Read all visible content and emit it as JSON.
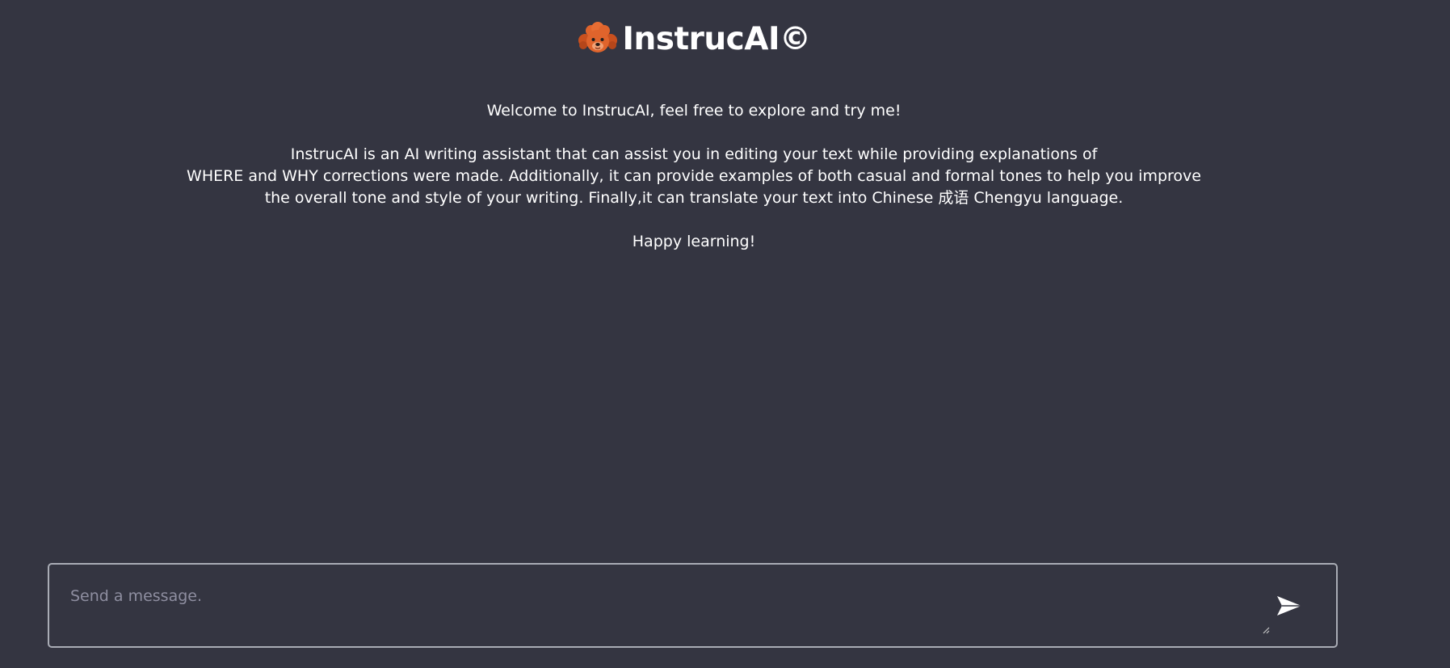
{
  "header": {
    "logo_icon": "poodle-dog-emoji-icon",
    "title": "InstrucAI©"
  },
  "intro": {
    "welcome": "Welcome to InstrucAI, feel free to explore and try me!",
    "description_lines": [
      "InstrucAI is an AI writing assistant that can assist you in editing your text while providing explanations of",
      "WHERE and WHY corrections were made. Additionally, it can provide examples of both casual and formal tones to help you improve",
      "the overall tone and style of your writing. Finally,it can translate your text into Chinese 成语 Chengyu language."
    ],
    "closing": "Happy learning!"
  },
  "composer": {
    "placeholder": "Send a message.",
    "value": "",
    "send_icon": "paper-plane-send-icon",
    "resize_icon": "resize-grip-icon"
  },
  "colors": {
    "background": "#343541",
    "text": "#ffffff",
    "placeholder": "#8e8ea0",
    "input_border": "#a9acb5",
    "logo_fur": "#e0642c"
  }
}
